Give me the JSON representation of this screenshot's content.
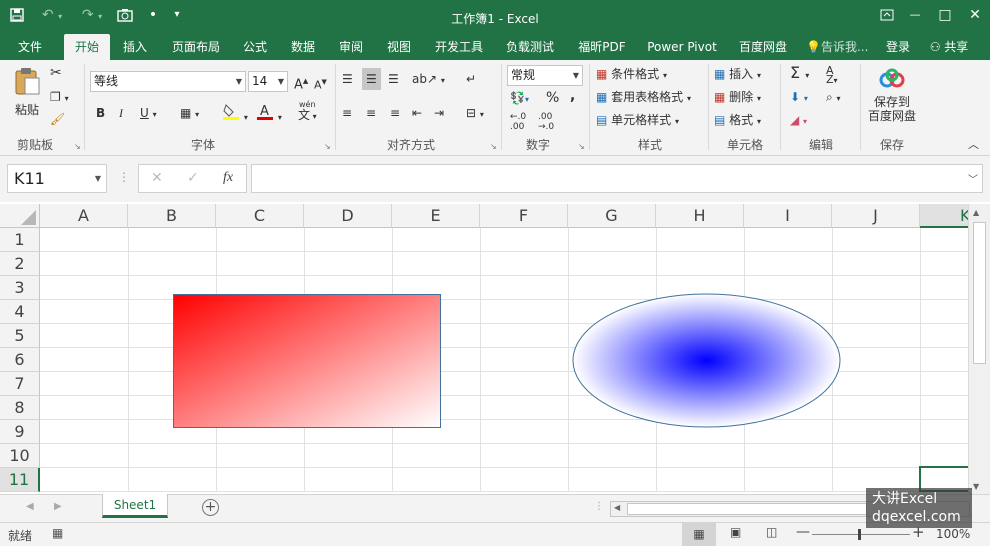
{
  "window": {
    "title": "工作簿1 - Excel"
  },
  "qat": {
    "save_icon": "save-icon",
    "undo_icon": "undo-icon",
    "redo_icon": "redo-icon",
    "camera_icon": "camera-icon",
    "dot": "•",
    "customize": "▾"
  },
  "window_controls": {
    "restore_ribbon": "ribbon-display-icon",
    "minimize": "—",
    "maximize": "□",
    "close": "✕"
  },
  "tabs": [
    "文件",
    "开始",
    "插入",
    "页面布局",
    "公式",
    "数据",
    "审阅",
    "视图",
    "开发工具",
    "负载测试",
    "福昕PDF",
    "Power Pivot",
    "百度网盘"
  ],
  "tell_me": "告诉我...",
  "login": "登录",
  "share": "共享",
  "ribbon": {
    "clipboard": {
      "paste": "粘贴",
      "label": "剪贴板"
    },
    "font": {
      "name": "等线",
      "size": "14",
      "bold": "B",
      "italic": "I",
      "underline": "U",
      "grow": "A",
      "shrink": "A",
      "label": "字体",
      "phonetic": "wén"
    },
    "alignment": {
      "label": "对齐方式"
    },
    "number": {
      "format": "常规",
      "percent": "%",
      "comma": ",",
      "label": "数字"
    },
    "styles": {
      "conditional": "条件格式",
      "table": "套用表格格式",
      "cell": "单元格样式",
      "label": "样式"
    },
    "cells": {
      "insert": "插入",
      "delete": "删除",
      "format": "格式",
      "label": "单元格"
    },
    "editing": {
      "label": "编辑"
    },
    "save": {
      "line1": "保存到",
      "line2": "百度网盘",
      "label": "保存"
    }
  },
  "formula_bar": {
    "name_box": "K11",
    "cancel": "✕",
    "enter": "✓",
    "fx": "fx",
    "value": ""
  },
  "columns": [
    "A",
    "B",
    "C",
    "D",
    "E",
    "F",
    "G",
    "H",
    "I",
    "J",
    "K"
  ],
  "rows": [
    "1",
    "2",
    "3",
    "4",
    "5",
    "6",
    "7",
    "8",
    "9",
    "10",
    "11"
  ],
  "selected_cell": "K11",
  "shapes": {
    "rectangle": {
      "gradient_from": "#ff0000",
      "gradient_to": "#ffffff",
      "border": "#41719c"
    },
    "ellipse": {
      "center": "#0000ff",
      "edge": "#ffffff",
      "border": "#41719c"
    }
  },
  "sheets": [
    "Sheet1"
  ],
  "active_sheet": "Sheet1",
  "status": {
    "ready": "就绪",
    "zoom": "100%"
  },
  "watermark": {
    "line1": "大讲Excel",
    "line2": "dqexcel.com"
  },
  "colors": {
    "accent": "#217346",
    "ribbon_bg": "#f3f3f3"
  }
}
